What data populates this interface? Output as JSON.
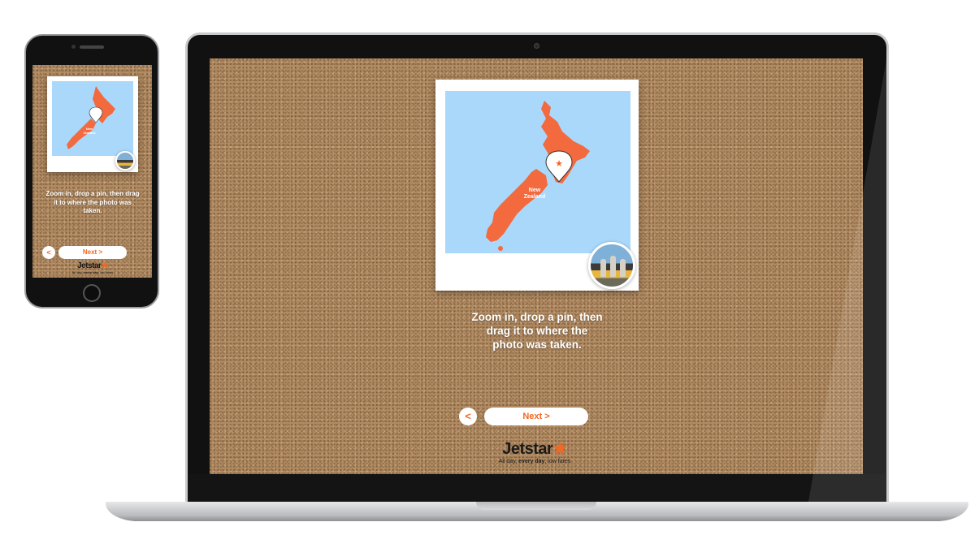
{
  "instruction": "Zoom in, drop a pin, then drag it to where the photo was taken.",
  "laptop_instruction": {
    "line1": "Zoom in, drop a pin, then",
    "line2": "drag it to where the",
    "line3": "photo was taken."
  },
  "phone_instruction": {
    "line1": "Zoom in, drop a pin, then drag",
    "line2": "it to where the photo was",
    "line3": "taken."
  },
  "map": {
    "label_line1": "New",
    "label_line2": "Zealand",
    "land_color": "#f26a3e",
    "water_color": "#a9d8fb"
  },
  "navigation": {
    "back_label": "<",
    "next_label": "Next >"
  },
  "brand": {
    "name": "Jetstar",
    "star": "★",
    "tagline_prefix": "All day, ",
    "tagline_bold": "every day",
    "tagline_suffix": ", low fares",
    "accent": "#f26722"
  },
  "icons": {
    "pin": "map-pin-icon",
    "back": "chevron-left-icon",
    "logo_star": "star-icon"
  }
}
